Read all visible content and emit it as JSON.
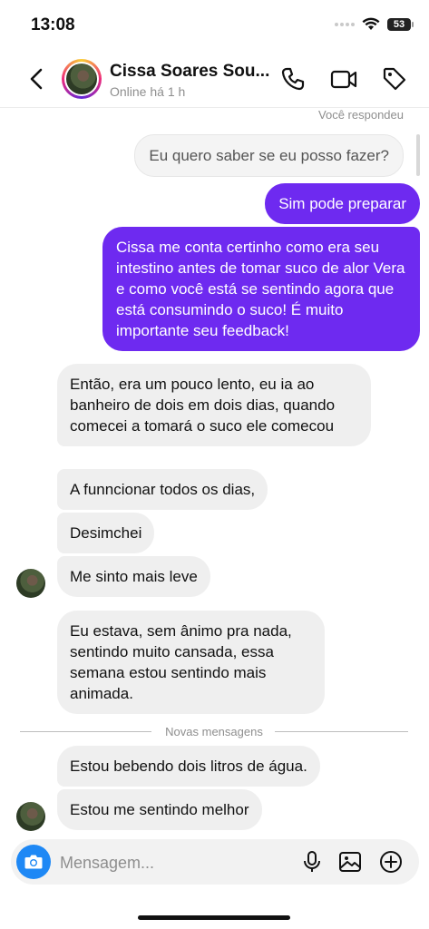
{
  "status_bar": {
    "time": "13:08",
    "battery": "53"
  },
  "header": {
    "contact_name": "Cissa Soares Sou...",
    "contact_status": "Online há 1 h",
    "icons": [
      "back-arrow-icon",
      "phone-icon",
      "video-icon",
      "tag-icon"
    ]
  },
  "chat": {
    "replied_label": "Você respondeu",
    "quoted_message": "Eu quero  saber se eu posso  fazer?",
    "outgoing": [
      "Sim pode preparar",
      "Cissa me conta certinho como era seu intestino antes de tomar suco de alor Vera e como você está se sentindo agora que está consumindo o suco! É muito importante seu feedback!"
    ],
    "incoming_group1": [
      "Então, era um pouco lento, eu ia ao banheiro  de dois em dois dias, quando  comecei  a tomará o suco ele comecou",
      "A funncionar todos os dias,",
      "Desimchei",
      "Me sinto  mais leve"
    ],
    "incoming_group2": "Eu estava, sem ânimo pra nada, sentindo  muito  cansada, essa semana  estou sentindo  mais animada.",
    "new_messages_label": "Novas mensagens",
    "incoming_group3": [
      "Estou bebendo  dois litros  de água.",
      "Estou  me sentindo  melhor"
    ]
  },
  "composer": {
    "placeholder": "Mensagem...",
    "icons": [
      "camera-icon",
      "microphone-icon",
      "gallery-icon",
      "add-icon"
    ]
  },
  "colors": {
    "accent_purple": "#6e2af0",
    "camera_blue": "#1e88f5",
    "bubble_grey": "#efefef"
  }
}
